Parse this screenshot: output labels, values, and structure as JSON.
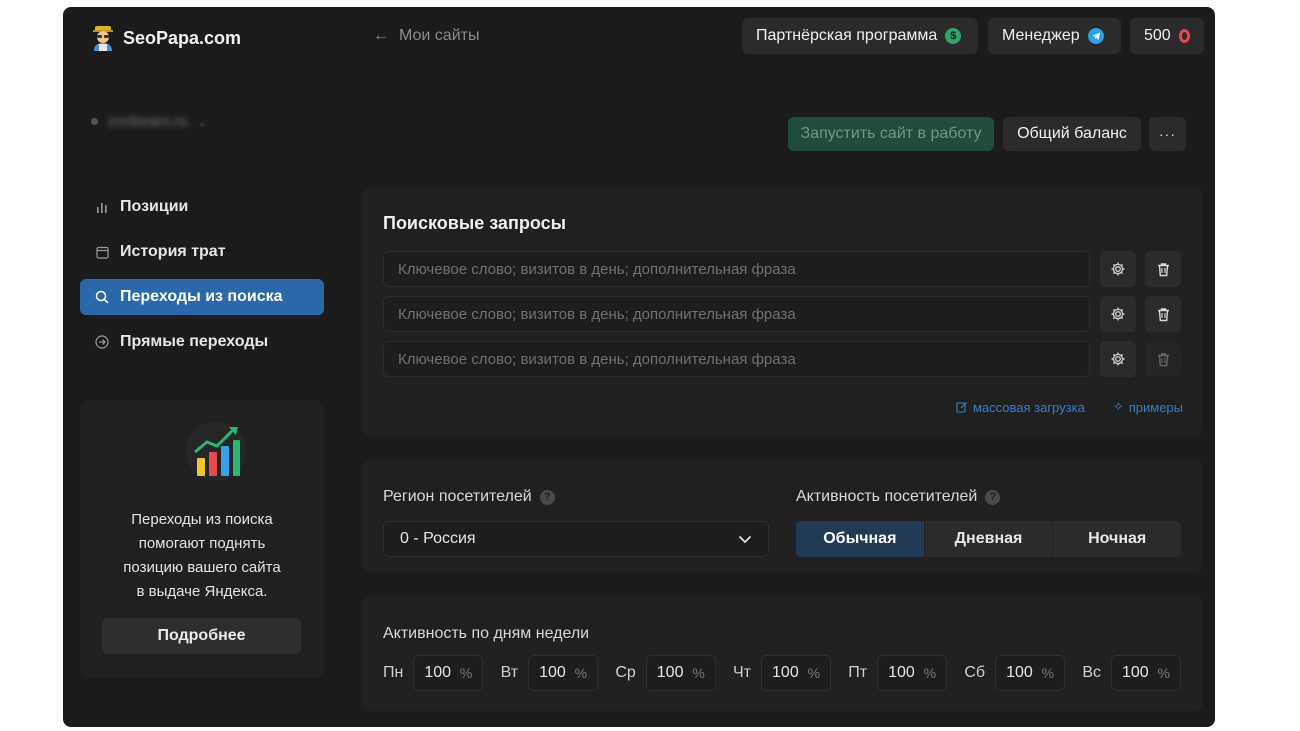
{
  "header": {
    "logo_text": "SeoPapa.com",
    "back_label": "Мои сайты",
    "partner_label": "Партнёрская программа",
    "manager_label": "Менеджер",
    "balance_value": "500"
  },
  "site": {
    "name": "zoobears.ru"
  },
  "actions": {
    "launch_label": "Запустить сайт в работу",
    "total_balance_label": "Общий баланс",
    "more_label": "···"
  },
  "sidebar": {
    "items": [
      {
        "label": "Позиции",
        "icon": "bar-chart-icon"
      },
      {
        "label": "История трат",
        "icon": "calendar-icon"
      },
      {
        "label": "Переходы из поиска",
        "icon": "search-icon"
      },
      {
        "label": "Прямые переходы",
        "icon": "arrow-circle-icon"
      }
    ],
    "active_index": 2,
    "promo": {
      "lines": [
        "Переходы из поиска",
        "помогают поднять",
        "позицию вашего сайта",
        "в выдаче Яндекса."
      ],
      "button_label": "Подробнее"
    }
  },
  "queries": {
    "title": "Поисковые запросы",
    "placeholder": "Ключевое слово; визитов в день; дополнительная фраза",
    "rows": [
      "",
      "",
      ""
    ],
    "bulk_upload_label": "массовая загрузка",
    "examples_label": "примеры"
  },
  "visitors": {
    "region_label": "Регион посетителей",
    "region_value": "0 - Россия",
    "activity_label": "Активность посетителей",
    "activity_options": [
      "Обычная",
      "Дневная",
      "Ночная"
    ],
    "activity_selected": "Обычная"
  },
  "weekdays": {
    "title": "Активность по дням недели",
    "days": [
      {
        "label": "Пн",
        "value": "100"
      },
      {
        "label": "Вт",
        "value": "100"
      },
      {
        "label": "Ср",
        "value": "100"
      },
      {
        "label": "Чт",
        "value": "100"
      },
      {
        "label": "Пт",
        "value": "100"
      },
      {
        "label": "Сб",
        "value": "100"
      },
      {
        "label": "Вс",
        "value": "100"
      }
    ],
    "unit": "%"
  },
  "colors": {
    "accent": "#2b68a9",
    "launch_bg": "#1f4d3b",
    "link": "#3a7ec6",
    "segment_active": "#223a55"
  }
}
